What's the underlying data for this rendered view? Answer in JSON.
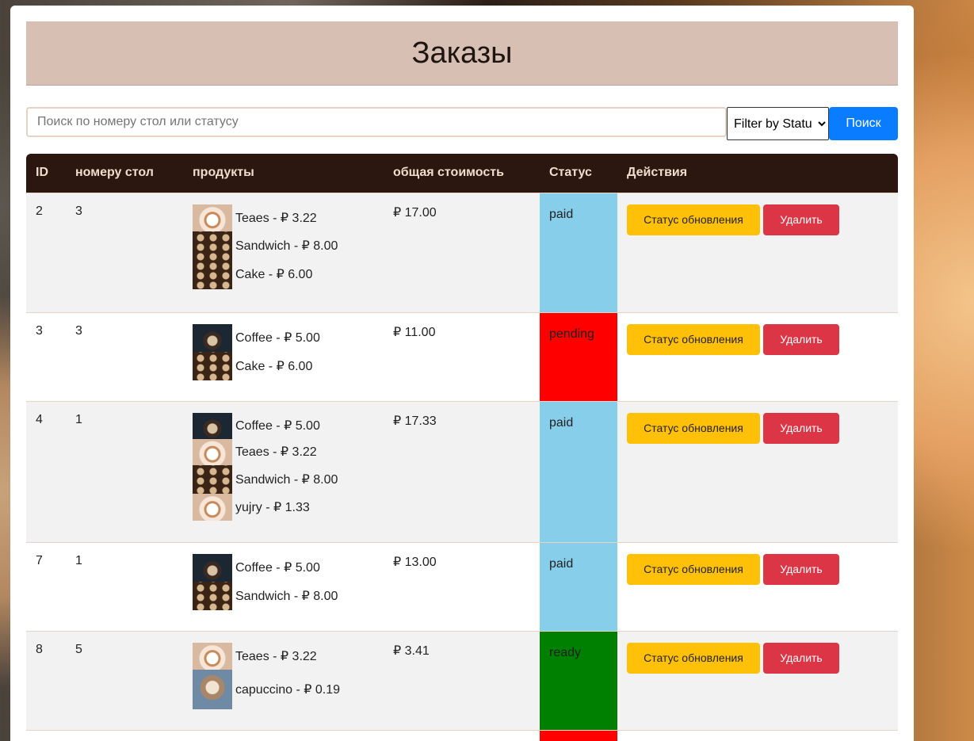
{
  "header": {
    "title": "Заказы"
  },
  "search": {
    "placeholder": "Поиск по номеру стол или статусу",
    "value": "",
    "filter_selected": "Filter by Status",
    "button_label": "Поиск"
  },
  "table": {
    "columns": [
      "ID",
      "номеру стол",
      "продукты",
      "общая стоимость",
      "Статус",
      "Действия"
    ],
    "update_label": "Статус обновления",
    "delete_label": "Удалить",
    "rows": [
      {
        "id": "2",
        "table": "3",
        "total": "₽ 17.00",
        "status": "paid",
        "products": [
          {
            "label": "Teaes - ₽ 3.22",
            "icon": "tea-thumbnail"
          },
          {
            "label": "Sandwich - ₽ 8.00",
            "icon": "cookies-thumbnail"
          },
          {
            "label": "Cake - ₽ 6.00",
            "icon": "cookies-thumbnail"
          }
        ]
      },
      {
        "id": "3",
        "table": "3",
        "total": "₽ 11.00",
        "status": "pending",
        "products": [
          {
            "label": "Coffee - ₽ 5.00",
            "icon": "coffee-thumbnail"
          },
          {
            "label": "Cake - ₽ 6.00",
            "icon": "cookies-thumbnail"
          }
        ]
      },
      {
        "id": "4",
        "table": "1",
        "total": "₽ 17.33",
        "status": "paid",
        "products": [
          {
            "label": "Coffee - ₽ 5.00",
            "icon": "coffee-thumbnail"
          },
          {
            "label": "Teaes - ₽ 3.22",
            "icon": "tea-thumbnail"
          },
          {
            "label": "Sandwich - ₽ 8.00",
            "icon": "cookies-thumbnail"
          },
          {
            "label": "yujry - ₽ 1.33",
            "icon": "tea-thumbnail"
          }
        ]
      },
      {
        "id": "7",
        "table": "1",
        "total": "₽ 13.00",
        "status": "paid",
        "products": [
          {
            "label": "Coffee - ₽ 5.00",
            "icon": "coffee-thumbnail"
          },
          {
            "label": "Sandwich - ₽ 8.00",
            "icon": "cookies-thumbnail"
          }
        ]
      },
      {
        "id": "8",
        "table": "5",
        "total": "₽ 3.41",
        "status": "ready",
        "products": [
          {
            "label": "Teaes - ₽ 3.22",
            "icon": "tea-thumbnail"
          },
          {
            "label": "capuccino - ₽ 0.19",
            "icon": "cappuccino-thumbnail"
          }
        ]
      }
    ]
  },
  "status_colors": {
    "paid": "#87ceeb",
    "pending": "#ff0000",
    "ready": "#008000"
  }
}
